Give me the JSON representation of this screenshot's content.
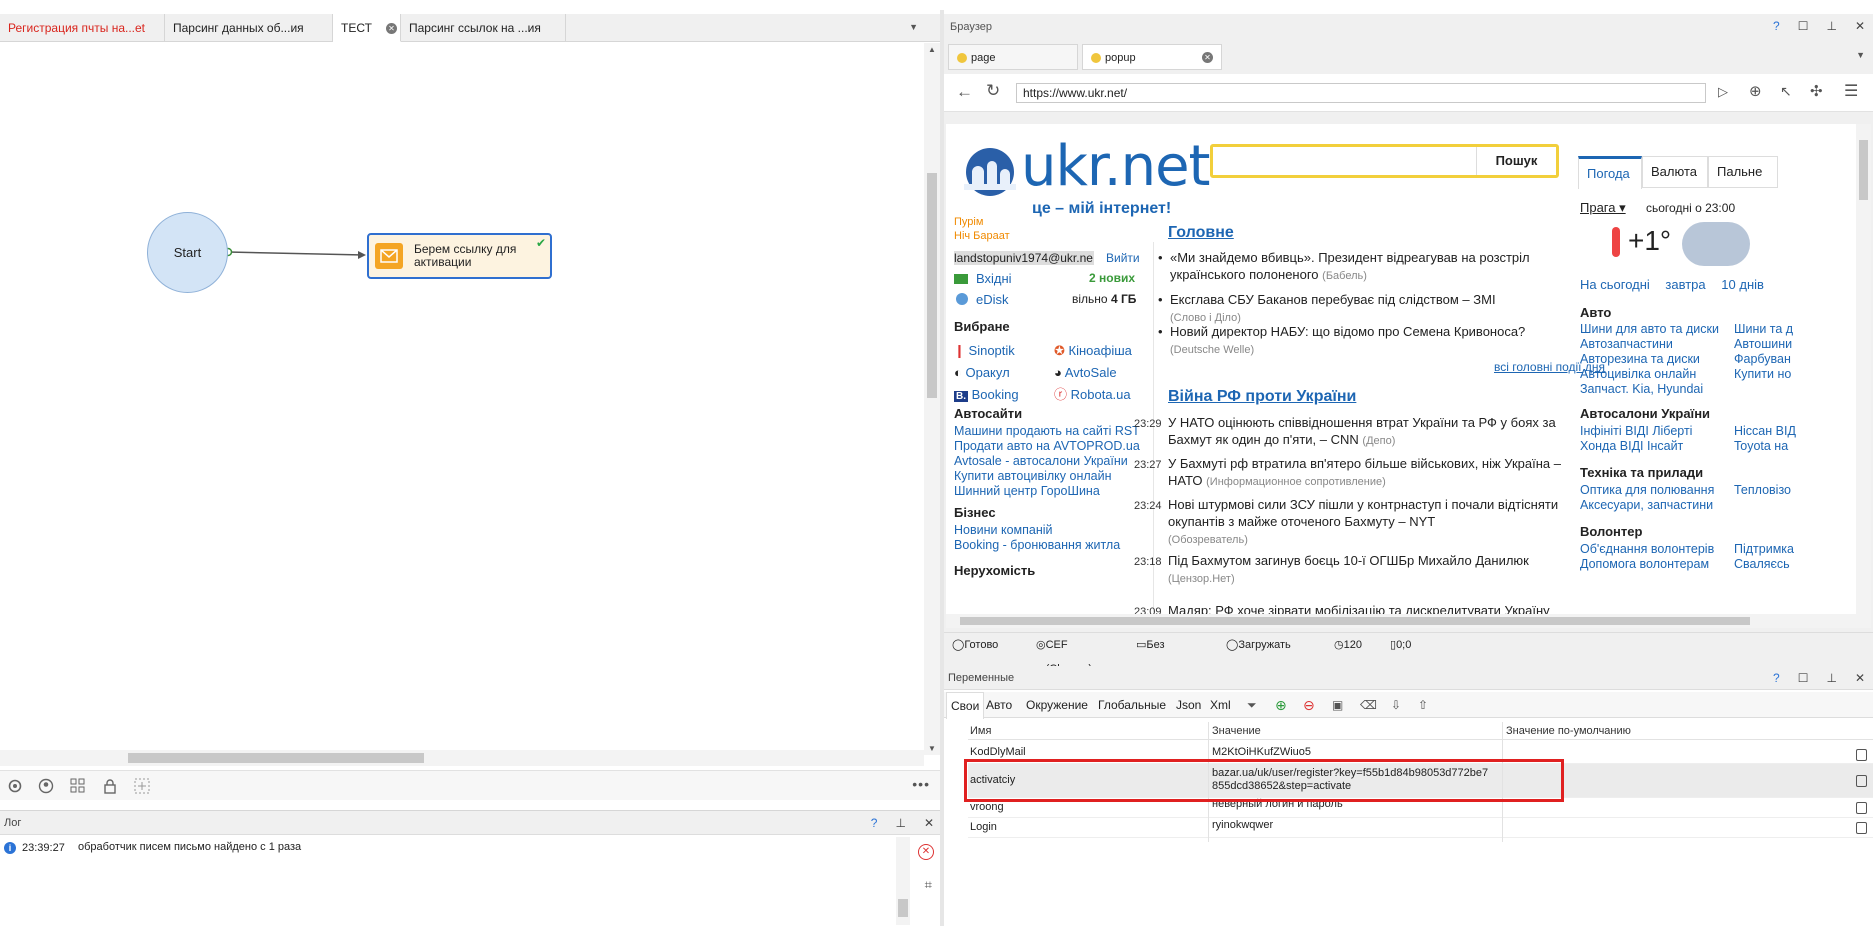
{
  "left": {
    "tabs": [
      {
        "label": "Регистрация пчты на...et",
        "color": "#d9251d"
      },
      {
        "label": "Парсинг данных об...ия"
      },
      {
        "label": "ТЕСТ"
      },
      {
        "label": "Парсинг ссылок на ...ия"
      }
    ],
    "start_label": "Start",
    "action_label": "Берем ссылку для активации"
  },
  "log": {
    "title": "Лог",
    "entry_time": "23:39:27",
    "entry_text": "обработчик писем письмо найдено с 1 раза"
  },
  "browser": {
    "title": "Браузер",
    "tabs": [
      "page",
      "popup"
    ],
    "url": "https://www.ukr.net/",
    "status": {
      "ready": "Готово",
      "engine": "CEF (Chrome)",
      "proxy": "Без прокси",
      "load": "Загружать все",
      "timeout": "120",
      "coords": "0;0"
    }
  },
  "site": {
    "logo": "ukr.net",
    "slogan": "це – мій інтернет!",
    "search_button": "Пошук",
    "holiday1": "Пурім",
    "holiday2": "Ніч Бараат",
    "email": "landstopuniv1974@ukr.ne",
    "logout": "Вийти",
    "inbox": "Вхідні",
    "inbox_new": "2 нових",
    "edisk": "eDisk",
    "edisk_free": "вільно",
    "edisk_size": "4 ГБ",
    "favorites_title": "Вибране",
    "favorites": [
      "Sinoptik",
      "Кіноафіша",
      "Оракул",
      "AvtoSale",
      "Booking",
      "Robota.ua"
    ],
    "auto_title": "Автосайти",
    "auto_links": [
      "Машини продають на сайті RST",
      "Продати авто на AVTOPROD.ua",
      "Avtosale - автосалони України",
      "Купити автоцивілку онлайн",
      "Шинний центр ГороШина"
    ],
    "biz_title": "Бізнес",
    "biz_links": [
      "Новини компаній",
      "Booking - бронювання житла"
    ],
    "realty_title": "Нерухомість",
    "main_title": "Головне",
    "main_news": [
      {
        "text": "«Ми знайдемо вбивць». Президент відреагував на розстріл українського полоненого",
        "src": "(Бабель)"
      },
      {
        "text": "Ексглава СБУ Баканов перебуває під слідством – ЗМІ",
        "src": "(Слово і Діло)"
      },
      {
        "text": "Новий директор НАБУ: що відомо про Семена Кривоноса?",
        "src": "(Deutsche Welle)"
      }
    ],
    "all_news": "всі головні події дня",
    "war_title": "Війна РФ проти України",
    "war_news": [
      {
        "time": "23:29",
        "text": "У НАТО оцінюють співвідношення втрат України та РФ у боях за Бахмут як один до п'яти, – CNN",
        "src": "(Депо)"
      },
      {
        "time": "23:27",
        "text": "У Бахмуті рф втратила вп'ятеро більше військових, ніж Україна – НАТО",
        "src": "(Информационное сопротивление)"
      },
      {
        "time": "23:24",
        "text": "Нові штурмові сили ЗСУ пішли у контрнаступ і почали відтісняти окупантів з майже оточеного Бахмуту – NYT",
        "src": "(Обозреватель)"
      },
      {
        "time": "23:18",
        "text": "Під Бахмутом загинув боєць 10-ї ОГШБр Михайло Данилюк",
        "src": "(Цензор.Нет)"
      },
      {
        "time": "23:09",
        "text": "Мадяр: РФ хоче зірвати мобілізацію та дискредитувати Україну",
        "src": ""
      }
    ],
    "weather_tabs": [
      "Погода",
      "Валюта",
      "Пальне"
    ],
    "city": "Прага",
    "today_at": "сьогодні о 23:00",
    "temp": "+1°",
    "weather_links": [
      "На сьогодні",
      "завтра",
      "10 днів"
    ],
    "auto2_title": "Авто",
    "auto2_links": [
      "Шини для авто та диски",
      "Автозапчастини",
      "Авторезина та диски",
      "Автоцивілка онлайн",
      "Запчаст. Kia, Hyundai"
    ],
    "auto2_links_b": [
      "Шини та д",
      "Автошини",
      "Фарбуван",
      "Купити но"
    ],
    "salons_title": "Автосалони України",
    "salons": [
      "Інфініті ВІДІ Ліберті",
      "Хонда ВІДІ Інсайт"
    ],
    "salons_b": [
      "Ніссан ВІД",
      "Toyota на"
    ],
    "tech_title": "Техніка та прилади",
    "tech": [
      "Оптика для полювання",
      "Аксесуари, запчастини"
    ],
    "tech_b": [
      "Тепловізо"
    ],
    "vol_title": "Волонтер",
    "vol": [
      "Об'єднання волонтерів",
      "Допомога волонтерам"
    ],
    "vol_b": [
      "Підтримка",
      "Сваляєсь"
    ]
  },
  "vars": {
    "title": "Переменные",
    "tabs": [
      "Свои",
      "Авто",
      "Окружение",
      "Глобальные",
      "Json",
      "Xml"
    ],
    "columns": [
      "Имя",
      "Значение",
      "Значение по-умолчанию"
    ],
    "rows": [
      {
        "name": "KodDlyMail",
        "value": "M2KtOiHKufZWiuo5"
      },
      {
        "name": "activatciy",
        "value": "bazar.ua/uk/user/register?key=f55b1d84b98053d772be7 855dcd38652&step=activate"
      },
      {
        "name": "vroong",
        "value": "неверный логин и пароль"
      },
      {
        "name": "Login",
        "value": "ryinokwqwer"
      }
    ]
  },
  "colors": {
    "accent": "#1d66b3",
    "highlight": "#e02020",
    "node_border": "#2f6fd0",
    "action_icon": "#f4a524"
  }
}
